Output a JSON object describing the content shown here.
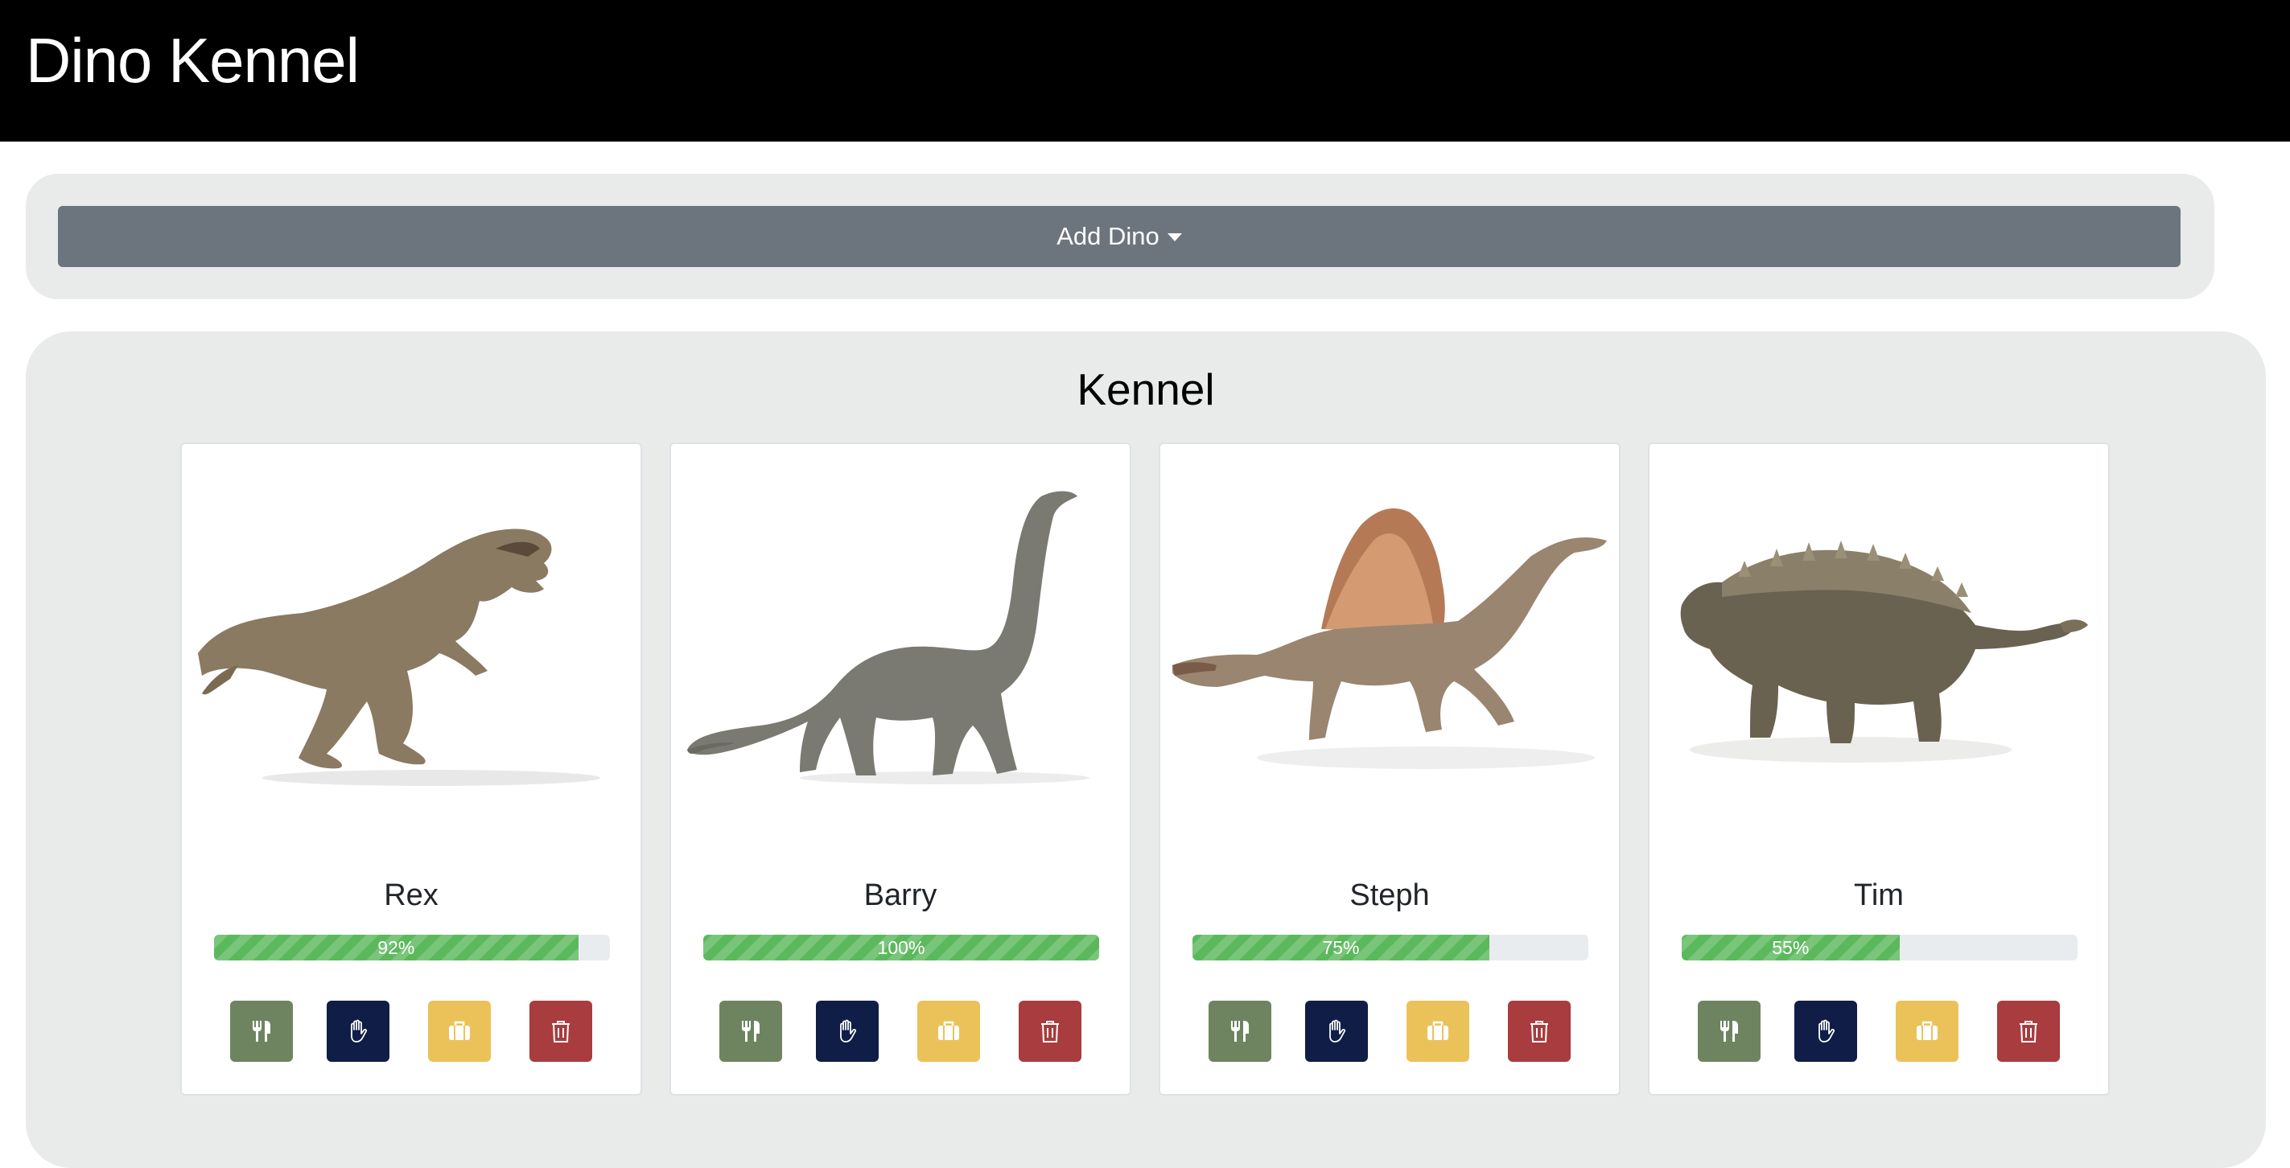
{
  "header": {
    "title": "Dino Kennel"
  },
  "add_panel": {
    "button_label": "Add Dino"
  },
  "kennel": {
    "title": "Kennel",
    "dinos": [
      {
        "name": "Rex",
        "happiness": 92,
        "happiness_label": "92%",
        "image_icon": "tyrannosaurus-image"
      },
      {
        "name": "Barry",
        "happiness": 100,
        "happiness_label": "100%",
        "image_icon": "brontosaurus-image"
      },
      {
        "name": "Steph",
        "happiness": 75,
        "happiness_label": "75%",
        "image_icon": "spinosaurus-image"
      },
      {
        "name": "Tim",
        "happiness": 55,
        "happiness_label": "55%",
        "image_icon": "ankylosaurus-image"
      }
    ]
  },
  "action_icons": [
    "fork-knife-icon",
    "hand-icon",
    "briefcase-icon",
    "trash-icon"
  ],
  "colors": {
    "feed": "#6e8460",
    "pet": "#0f1d47",
    "play": "#ebc25a",
    "delete": "#a83c3e",
    "progress": "#5cb85c",
    "add_button": "#6c757d"
  }
}
